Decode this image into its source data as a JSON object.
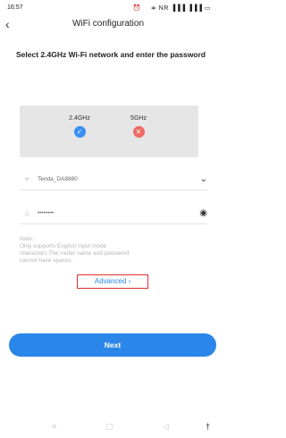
{
  "status_bar": {
    "time": "16:57",
    "icons": "⏰  ≑ NR ▐▐▐ ▐▐▐ ▭"
  },
  "header": {
    "back_glyph": "‹",
    "title": "WiFi configuration"
  },
  "instruction": "Select 2.4GHz Wi-Fi network and enter the password",
  "bands": [
    {
      "label": "2.4GHz",
      "mark": "✓",
      "status_color": "#3b8ff2"
    },
    {
      "label": "5GHz",
      "mark": "✕",
      "status_color": "#ee6b63"
    }
  ],
  "ssid": {
    "icon": "wifi-icon",
    "icon_glyph": "≈",
    "value": "Tenda_DA8880",
    "dropdown_glyph": "⌄"
  },
  "password": {
    "icon": "lock-icon",
    "icon_glyph": "⌂",
    "value": "••••••••",
    "eye_glyph": "◉"
  },
  "note": {
    "title": "Note：",
    "lines": [
      "Only supports English input mode",
      "characters.The router name and password",
      "cannot have spaces."
    ]
  },
  "advanced_label": "Advanced ›",
  "next_label": "Next",
  "nav": {
    "menu": "≡",
    "home": "▢",
    "back": "◁",
    "extra": "†"
  },
  "colors": {
    "accent": "#2a86e8",
    "highlight_border": "#e2302f",
    "card_bg": "#e6e6e6"
  }
}
